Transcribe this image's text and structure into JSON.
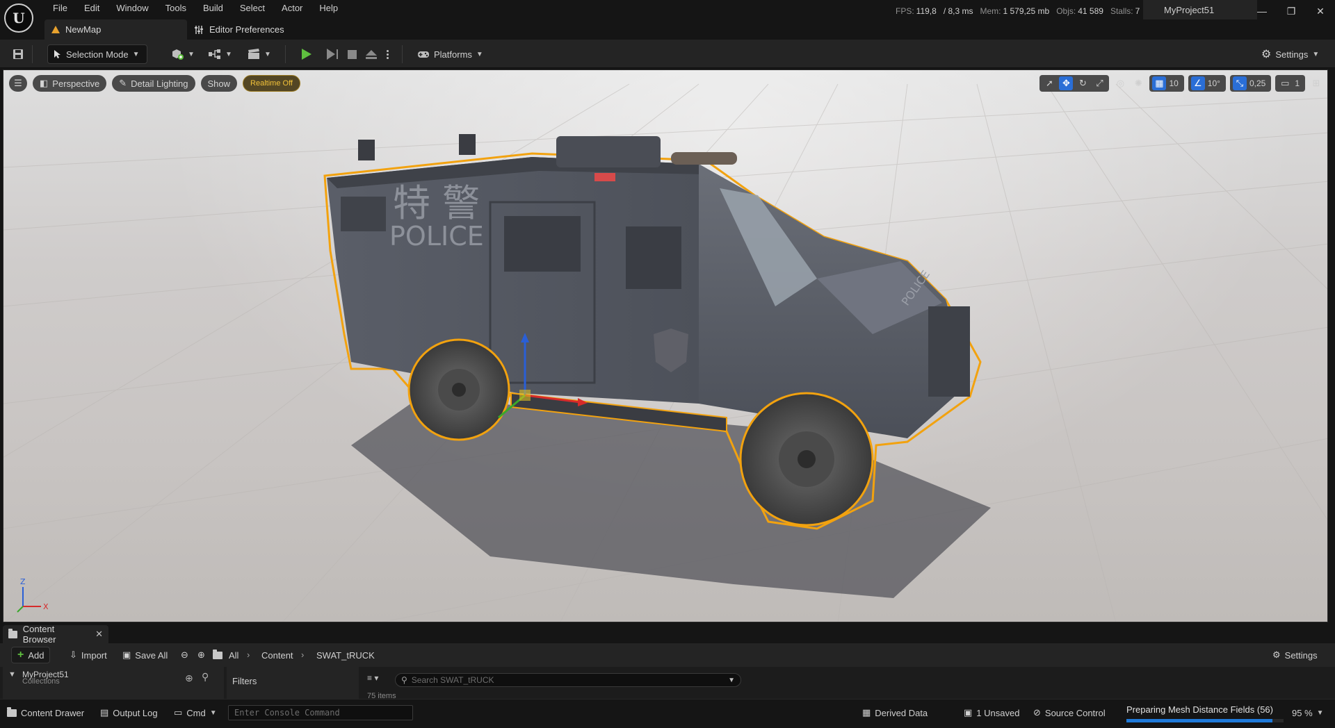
{
  "menu": [
    "File",
    "Edit",
    "Window",
    "Tools",
    "Build",
    "Select",
    "Actor",
    "Help"
  ],
  "tabs": {
    "level": "NewMap",
    "prefs": "Editor Preferences"
  },
  "stats": {
    "fps_label": "FPS:",
    "fps": "119,8",
    "ms": "/ 8,3 ms",
    "mem_label": "Mem:",
    "mem": "1 579,25 mb",
    "objs_label": "Objs:",
    "objs": "41 589",
    "stalls_label": "Stalls:",
    "stalls": "7"
  },
  "project": "MyProject51",
  "window_controls": {
    "minimize": "—",
    "restore": "❐",
    "close": "✕"
  },
  "toolbar": {
    "selection_mode": "Selection Mode",
    "platforms": "Platforms",
    "settings": "Settings"
  },
  "viewport": {
    "perspective": "Perspective",
    "lighting": "Detail Lighting",
    "show": "Show",
    "realtime": "Realtime Off",
    "grid_snap": "10",
    "rot_snap": "10°",
    "scale_snap": "0,25",
    "camera_speed": "1",
    "truck_text_cn": "特 警",
    "truck_text_police": "POLICE",
    "hood_text": "POLICE",
    "axis_z": "Z",
    "axis_x": "X"
  },
  "content_browser": {
    "tab_title": "Content Browser",
    "add": "Add",
    "import": "Import",
    "save_all": "Save All",
    "crumbs": [
      "All",
      "Content",
      "SWAT_tRUCK"
    ],
    "settings": "Settings",
    "collections": "Collections",
    "project_folder": "MyProject51",
    "filters": "Filters",
    "search_placeholder": "Search SWAT_tRUCK",
    "item_count": "75 items"
  },
  "statusbar": {
    "content_drawer": "Content Drawer",
    "output_log": "Output Log",
    "cmd": "Cmd",
    "console_placeholder": "Enter Console Command",
    "derived_data": "Derived Data",
    "unsaved": "1 Unsaved",
    "source_control": "Source Control",
    "progress_label": "Preparing Mesh Distance Fields (56)",
    "progress_fraction": 0.93,
    "zoom": "95 %"
  },
  "colors": {
    "accent_blue": "#2a6ed6",
    "play_green": "#5fbf3f",
    "selection_orange": "#f2a20f",
    "realtime_yellow": "#f2c23a"
  }
}
